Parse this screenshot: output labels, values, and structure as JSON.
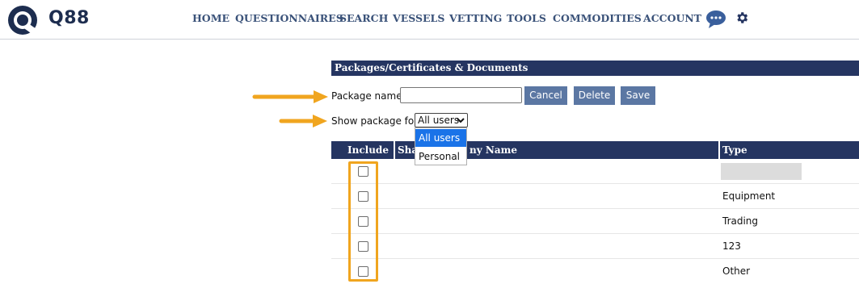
{
  "header": {
    "brand": "Q88",
    "nav": [
      "HOME",
      "QUESTIONNAIRES",
      "SEARCH",
      "VESSELS",
      "VETTING",
      "TOOLS",
      "COMMODITIES",
      "ACCOUNT"
    ],
    "icons": [
      "chat-bubble-icon",
      "gear-icon"
    ]
  },
  "section": {
    "title": "Packages/Certificates & Documents"
  },
  "form": {
    "package_name_label": "Package name:",
    "package_name_value": "",
    "cancel_label": "Cancel",
    "delete_label": "Delete",
    "save_label": "Save",
    "show_for_label": "Show package for:",
    "show_for_selected": "All users",
    "show_for_options": [
      "All users",
      "Personal"
    ]
  },
  "table": {
    "columns": [
      "Include",
      "Sha",
      "ny Name",
      "Type"
    ],
    "rows": [
      {
        "checked": false,
        "type": ""
      },
      {
        "checked": false,
        "type": "Equipment"
      },
      {
        "checked": false,
        "type": "Trading"
      },
      {
        "checked": false,
        "type": "123"
      },
      {
        "checked": false,
        "type": "Other"
      }
    ]
  },
  "colors": {
    "navy": "#253561",
    "nav_text": "#3a5279",
    "button": "#5b77a3",
    "annotation": "#f0a51f",
    "dropdown_highlight": "#1a73e8"
  }
}
